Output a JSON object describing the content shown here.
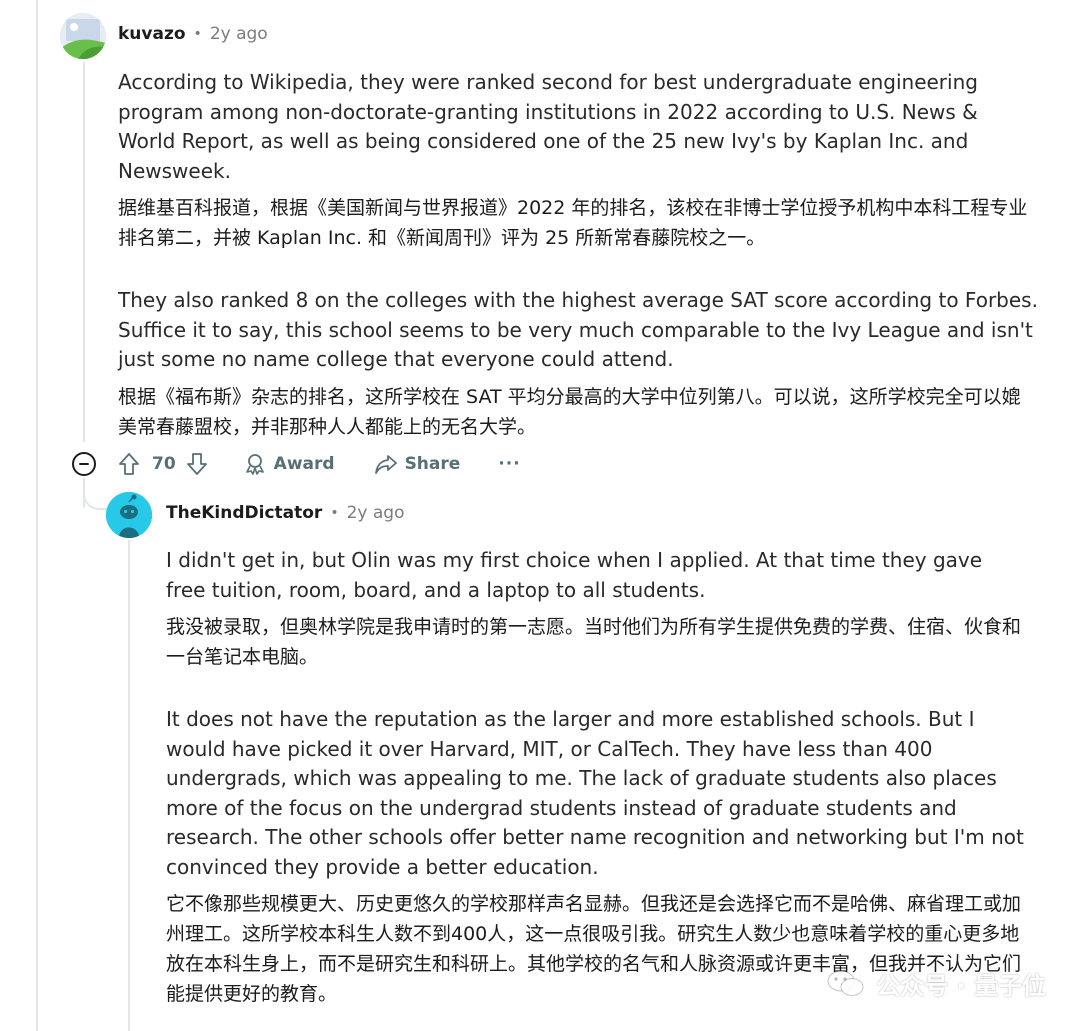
{
  "colors": {
    "thread_line": "#e3e6e8",
    "meta_gray": "#7c7c7c",
    "action_gray": "#576f76",
    "reply_avatar_bg": "#27c8e8"
  },
  "comment1": {
    "username": "kuvazo",
    "separator": "•",
    "time_ago": "2y ago",
    "avatar_icon": "default-landscape-avatar",
    "paragraphs": [
      {
        "lang": "en",
        "text": "According to Wikipedia, they were ranked second for best undergraduate engineering program among non-doctorate-granting institutions in 2022 according to U.S. News & World Report, as well as being considered one of the 25 new Ivy's by Kaplan Inc. and Newsweek."
      },
      {
        "lang": "zh",
        "text": "据维基百科报道，根据《美国新闻与世界报道》2022 年的排名，该校在非博士学位授予机构中本科工程专业排名第二，并被 Kaplan Inc. 和《新闻周刊》评为 25 所新常春藤院校之一。"
      },
      {
        "lang": "en",
        "text": "They also ranked 8 on the colleges with the highest average SAT score according to Forbes. Suffice it to say, this school seems to be very much comparable to the Ivy League and isn't just some no name college that everyone could attend."
      },
      {
        "lang": "zh",
        "text": "根据《福布斯》杂志的排名，这所学校在 SAT 平均分最高的大学中位列第八。可以说，这所学校完全可以媲美常春藤盟校，并非那种人人都能上的无名大学。"
      }
    ],
    "actions": {
      "score": "70",
      "award_label": "Award",
      "share_label": "Share",
      "more_label": "···"
    }
  },
  "comment2": {
    "username": "TheKindDictator",
    "separator": "•",
    "time_ago": "2y ago",
    "avatar_icon": "snoo-avatar",
    "paragraphs": [
      {
        "lang": "en",
        "text": "I didn't get in, but Olin was my first choice when I applied. At that time they gave free tuition, room, board, and a laptop to all students."
      },
      {
        "lang": "zh",
        "text": "我没被录取，但奥林学院是我申请时的第一志愿。当时他们为所有学生提供免费的学费、住宿、伙食和一台笔记本电脑。"
      },
      {
        "lang": "en",
        "text": "It does not have the reputation as the larger and more established schools. But I would have picked it over Harvard, MIT, or CalTech. They have less than 400 undergrads, which was appealing to me. The lack of graduate students also places more of the focus on the undergrad students instead of graduate students and research. The other schools offer better name recognition and networking but I'm not convinced they provide a better education."
      },
      {
        "lang": "zh",
        "text": "它不像那些规模更大、历史更悠久的学校那样声名显赫。但我还是会选择它而不是哈佛、麻省理工或加州理工。这所学校本科生人数不到400人，这一点很吸引我。研究生人数少也意味着学校的重心更多地放在本科生身上，而不是研究生和科研上。其他学校的名气和人脉资源或许更丰富，但我并不认为它们能提供更好的教育。"
      }
    ]
  },
  "watermark": {
    "text": "公众号 · 量子位",
    "icon": "wechat-icon"
  }
}
